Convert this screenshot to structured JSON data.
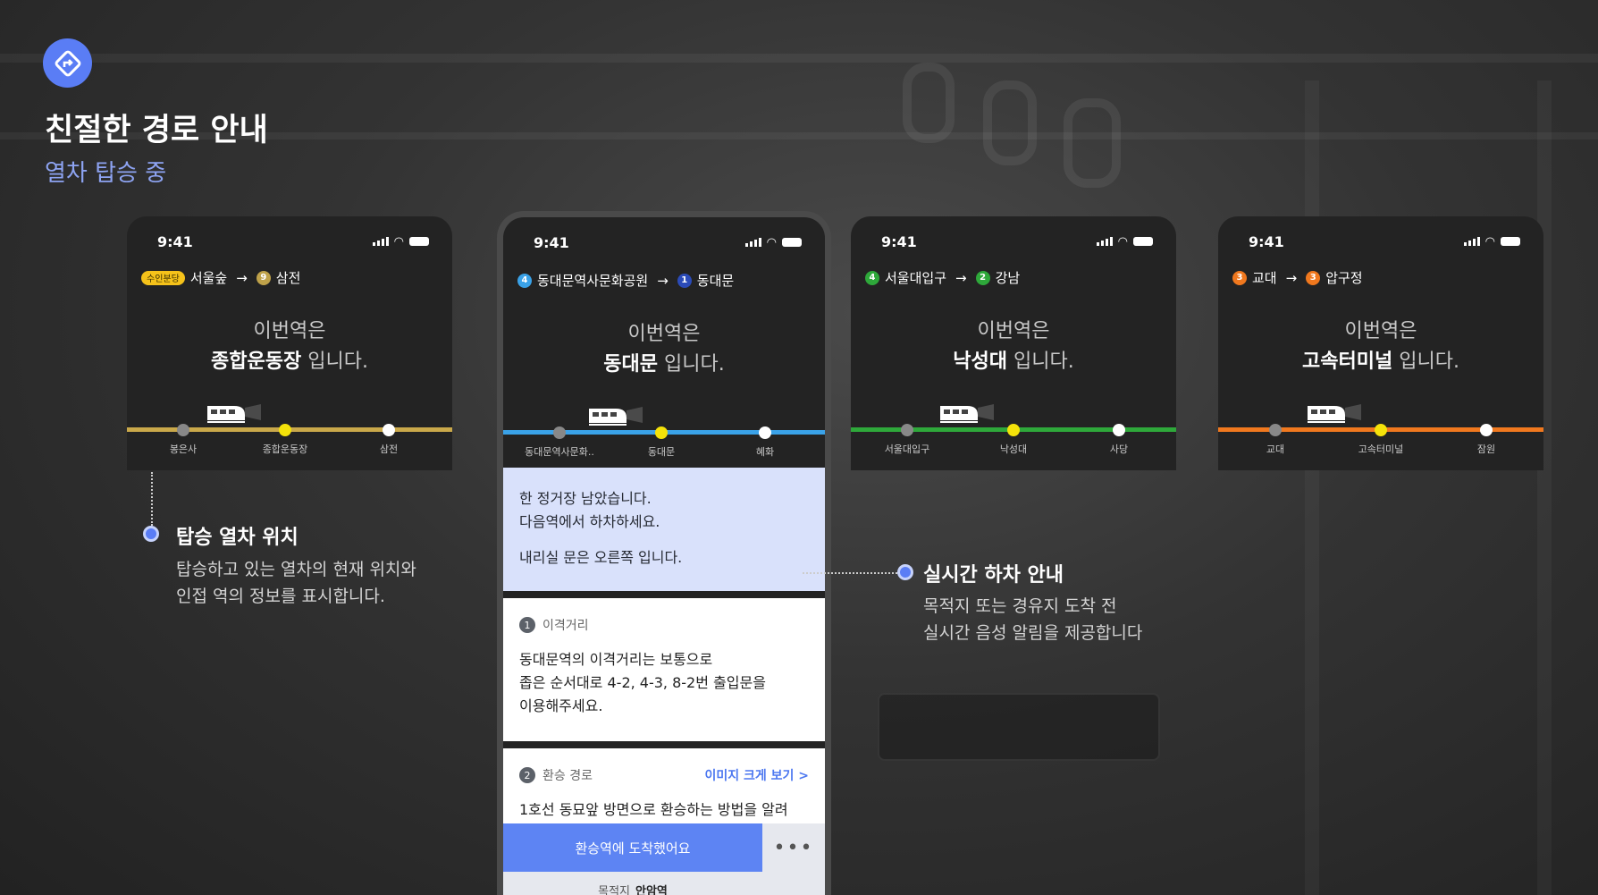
{
  "header": {
    "title": "친절한 경로 안내",
    "subtitle": "열차 탑승 중"
  },
  "phones": [
    {
      "time": "9:41",
      "route": {
        "from_badge": "수인분당",
        "from": "서울숲",
        "to_badge": "9",
        "to": "삼전"
      },
      "announce_line1": "이번역은",
      "announce_station": "종합운동장",
      "announce_suffix": " 입니다.",
      "line_color": "#c9a84a",
      "stations": [
        "봉은사",
        "종합운동장",
        "삼전"
      ]
    },
    {
      "time": "9:41",
      "route": {
        "from_badge": "4",
        "from": "동대문역사문화공원",
        "to_badge": "1",
        "to": "동대문"
      },
      "announce_line1": "이번역은",
      "announce_station": "동대문",
      "announce_suffix": " 입니다.",
      "line_color": "#3aa2e8",
      "stations": [
        "동대문역사문화..",
        "동대문",
        "혜화"
      ]
    },
    {
      "time": "9:41",
      "route": {
        "from_badge": "4",
        "from": "서울대입구",
        "to_badge": "2",
        "to": "강남"
      },
      "announce_line1": "이번역은",
      "announce_station": "낙성대",
      "announce_suffix": " 입니다.",
      "line_color": "#2ea83a",
      "stations": [
        "서울대입구",
        "낙성대",
        "사당"
      ]
    },
    {
      "time": "9:41",
      "route": {
        "from_badge": "3",
        "from": "교대",
        "to_badge": "3",
        "to": "압구정"
      },
      "announce_line1": "이번역은",
      "announce_station": "고속터미널",
      "announce_suffix": " 입니다.",
      "line_color": "#f0781e",
      "stations": [
        "교대",
        "고속터미널",
        "잠원"
      ]
    }
  ],
  "center": {
    "alert_line1": "한 정거장 남았습니다.",
    "alert_line2": "다음역에서 하차하세요.",
    "alert_line3": "내리실 문은 오른쪽 입니다.",
    "sec1_num": "1",
    "sec1_title": "이격거리",
    "sec1_body1": "동대문역의 이격거리는 보통으로",
    "sec1_body2": "좁은 순서대로 4-2, 4-3, 8-2번 출입문을",
    "sec1_body3": "이용해주세요.",
    "sec2_num": "2",
    "sec2_title": "환승 경로",
    "sec2_link": "이미지 크게 보기 >",
    "sec2_body": "1호선 동묘앞 방면으로 환승하는 방법을 알려",
    "cta": "환승역에 도착했어요",
    "more": "•••",
    "dest_label": "목적지",
    "dest_value": "안암역"
  },
  "annotations": {
    "left_title": "탑승 열차 위치",
    "left_desc1": "탑승하고 있는 열차의 현재 위치와",
    "left_desc2": "인접 역의 정보를 표시합니다.",
    "right_title": "실시간 하차 안내",
    "right_desc1": "목적지 또는 경유지 도착 전",
    "right_desc2": "실시간 음성 알림을 제공합니다"
  },
  "colors": {
    "accent": "#5a7df5",
    "line_suin": "#f5c21a",
    "line_9": "#bfa24a",
    "line_4": "#3aa2e8",
    "line_1": "#2b4bb8",
    "line_2": "#2ea83a",
    "line_3": "#f0781e"
  },
  "icons": {
    "logo": "route-diamond-icon",
    "train": "train-icon",
    "signal": "signal-icon",
    "wifi": "wifi-icon",
    "battery": "battery-icon"
  }
}
